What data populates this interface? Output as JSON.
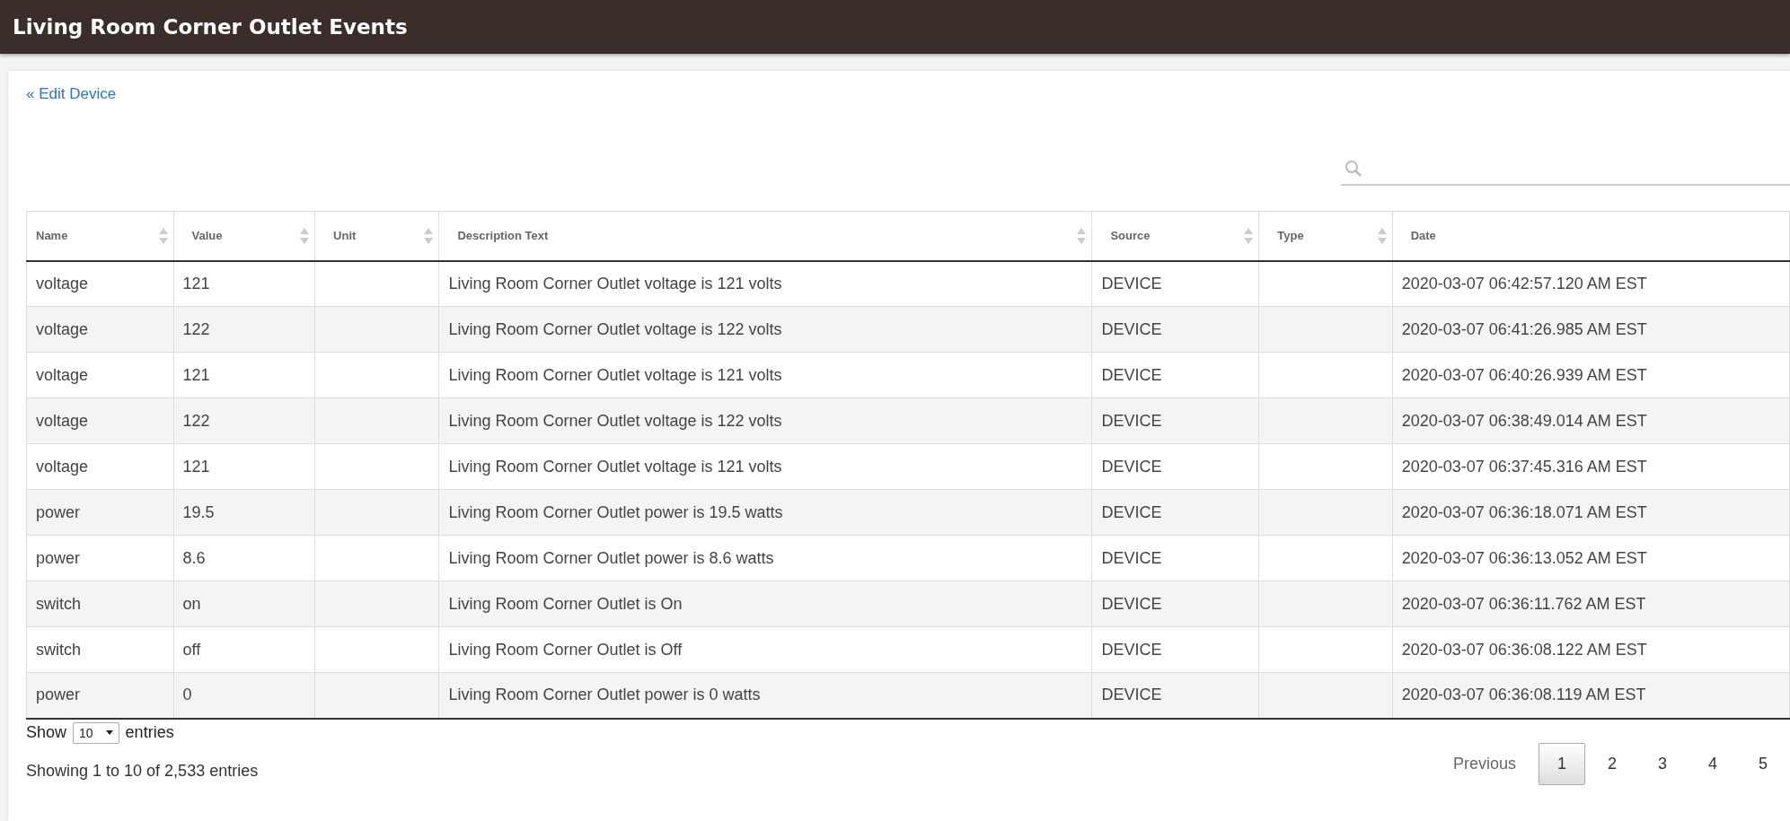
{
  "header": {
    "title": "Living Room Corner Outlet Events"
  },
  "back_link": "« Edit Device",
  "table": {
    "columns": [
      {
        "label": "Name",
        "sortable": true
      },
      {
        "label": "Value",
        "sortable": true
      },
      {
        "label": "Unit",
        "sortable": true
      },
      {
        "label": "Description Text",
        "sortable": true
      },
      {
        "label": "Source",
        "sortable": true
      },
      {
        "label": "Type",
        "sortable": true
      },
      {
        "label": "Date"
      }
    ],
    "rows": [
      [
        "voltage",
        "121",
        "",
        "Living Room Corner Outlet voltage is 121 volts",
        "DEVICE",
        "",
        "2020-03-07 06:42:57.120 AM EST"
      ],
      [
        "voltage",
        "122",
        "",
        "Living Room Corner Outlet voltage is 122 volts",
        "DEVICE",
        "",
        "2020-03-07 06:41:26.985 AM EST"
      ],
      [
        "voltage",
        "121",
        "",
        "Living Room Corner Outlet voltage is 121 volts",
        "DEVICE",
        "",
        "2020-03-07 06:40:26.939 AM EST"
      ],
      [
        "voltage",
        "122",
        "",
        "Living Room Corner Outlet voltage is 122 volts",
        "DEVICE",
        "",
        "2020-03-07 06:38:49.014 AM EST"
      ],
      [
        "voltage",
        "121",
        "",
        "Living Room Corner Outlet voltage is 121 volts",
        "DEVICE",
        "",
        "2020-03-07 06:37:45.316 AM EST"
      ],
      [
        "power",
        "19.5",
        "",
        "Living Room Corner Outlet power is 19.5 watts",
        "DEVICE",
        "",
        "2020-03-07 06:36:18.071 AM EST"
      ],
      [
        "power",
        "8.6",
        "",
        "Living Room Corner Outlet power is 8.6 watts",
        "DEVICE",
        "",
        "2020-03-07 06:36:13.052 AM EST"
      ],
      [
        "switch",
        "on",
        "",
        "Living Room Corner Outlet is On",
        "DEVICE",
        "",
        "2020-03-07 06:36:11.762 AM EST"
      ],
      [
        "switch",
        "off",
        "",
        "Living Room Corner Outlet is Off",
        "DEVICE",
        "",
        "2020-03-07 06:36:08.122 AM EST"
      ],
      [
        "power",
        "0",
        "",
        "Living Room Corner Outlet power is 0 watts",
        "DEVICE",
        "",
        "2020-03-07 06:36:08.119 AM EST"
      ]
    ]
  },
  "length_menu": {
    "before": "Show",
    "value": "10",
    "after": "entries"
  },
  "info": "Showing 1 to 10 of 2,533 entries",
  "pagination": {
    "previous": "Previous",
    "pages": [
      {
        "label": "1",
        "selected": true
      },
      {
        "label": "2",
        "selected": false
      },
      {
        "label": "3",
        "selected": false
      },
      {
        "label": "4",
        "selected": false
      },
      {
        "label": "5",
        "selected": false
      }
    ]
  }
}
